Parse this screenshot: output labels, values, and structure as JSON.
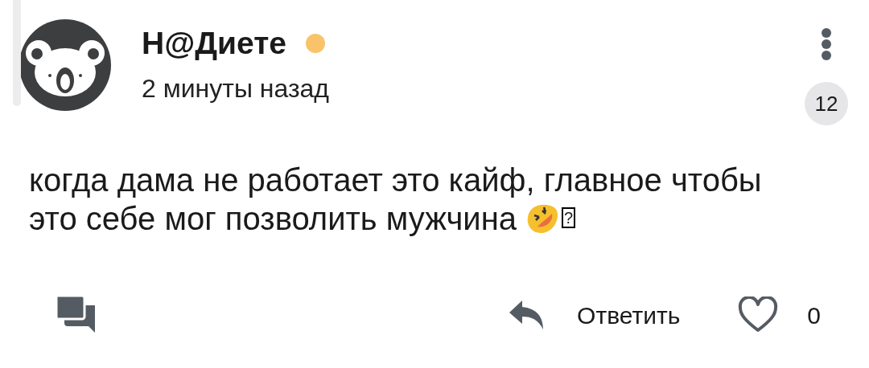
{
  "author": {
    "name": "Н@Диете",
    "online": true
  },
  "time": "2 минуты назад",
  "badge": "12",
  "comment": {
    "lines": [
      "когда дама не работает это кайф, главное чтобы",
      "это себе мог позволить мужчина"
    ],
    "missing_glyph": "?"
  },
  "actions": {
    "reply": "Ответить",
    "likes": "0",
    "liked": false
  }
}
